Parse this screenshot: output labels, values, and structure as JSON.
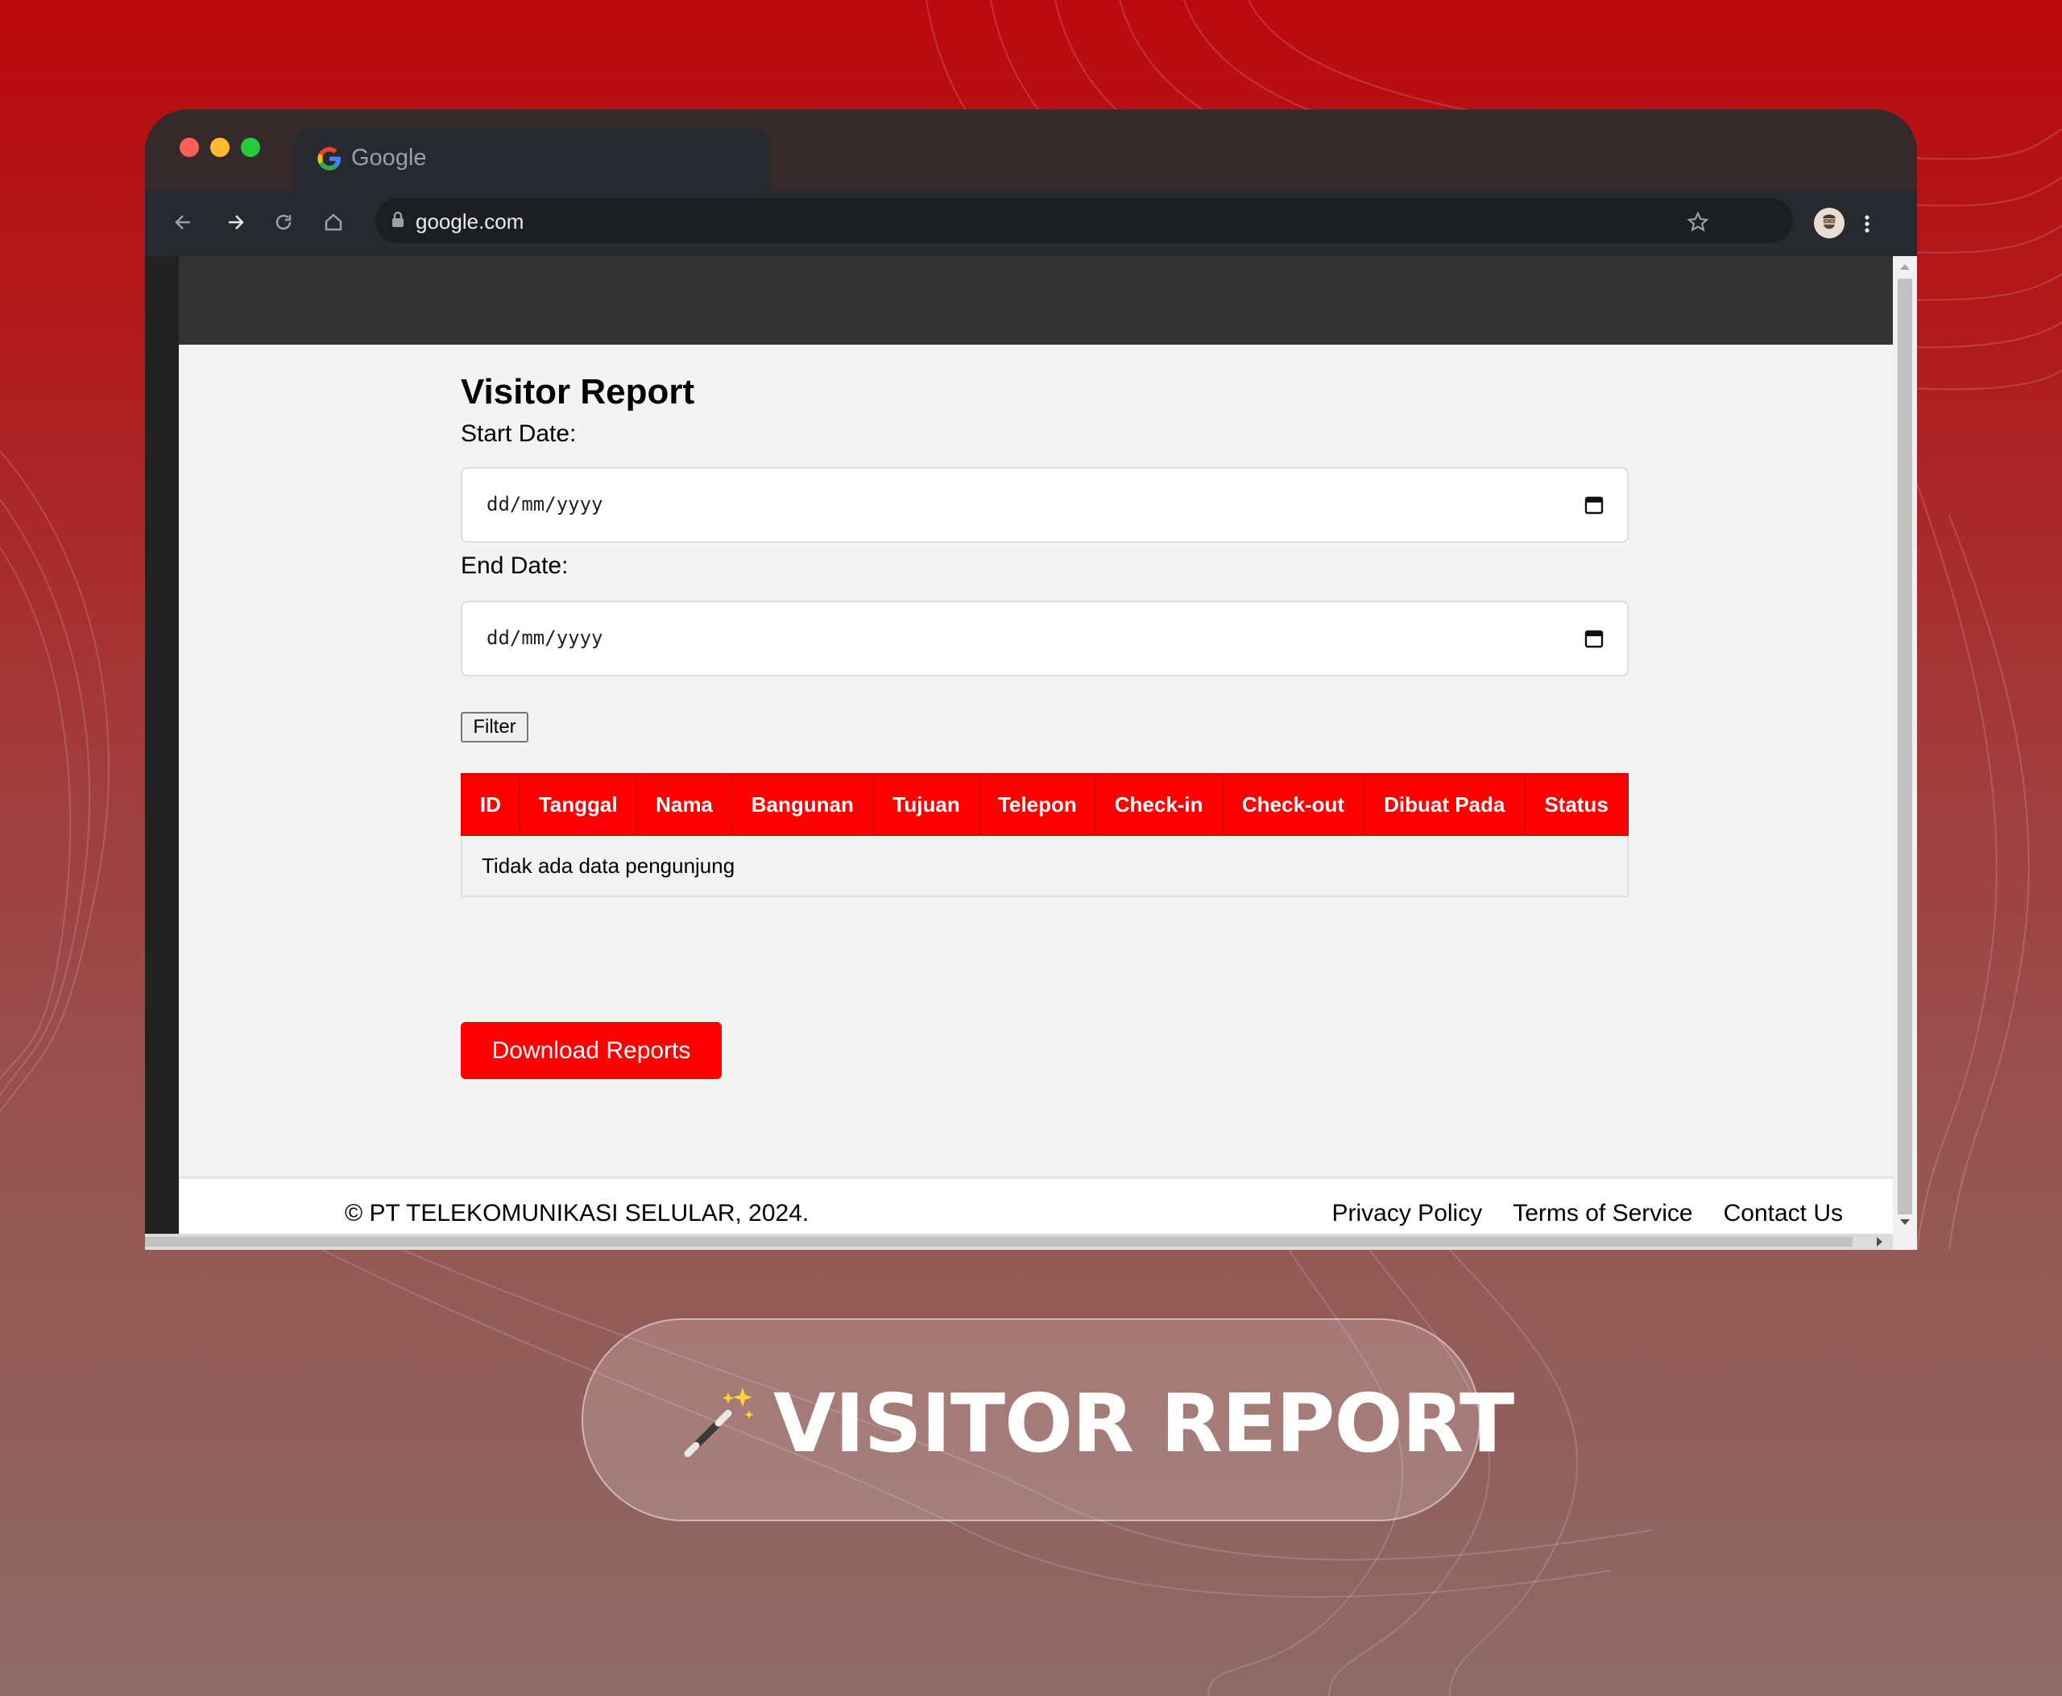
{
  "browser": {
    "tab_title": "Google",
    "url": "google.com"
  },
  "page": {
    "title": "Visitor Report",
    "start_date_label": "Start Date:",
    "start_date_placeholder": "dd/mm/yyyy",
    "end_date_label": "End Date:",
    "end_date_placeholder": "dd/mm/yyyy",
    "filter_label": "Filter",
    "table": {
      "columns": [
        "ID",
        "Tanggal",
        "Nama",
        "Bangunan",
        "Tujuan",
        "Telepon",
        "Check-in",
        "Check-out",
        "Dibuat Pada",
        "Status"
      ],
      "empty_message": "Tidak ada data pengunjung"
    },
    "download_label": "Download Reports"
  },
  "footer": {
    "copyright": "© PT TELEKOMUNIKASI SELULAR, 2024.",
    "links": [
      "Privacy Policy",
      "Terms of Service",
      "Contact Us"
    ]
  },
  "banner": {
    "title": "VISITOR REPORT"
  },
  "colors": {
    "accent": "#ff0000",
    "background_top": "#bb0a0f",
    "browser_frame": "#35292c"
  }
}
